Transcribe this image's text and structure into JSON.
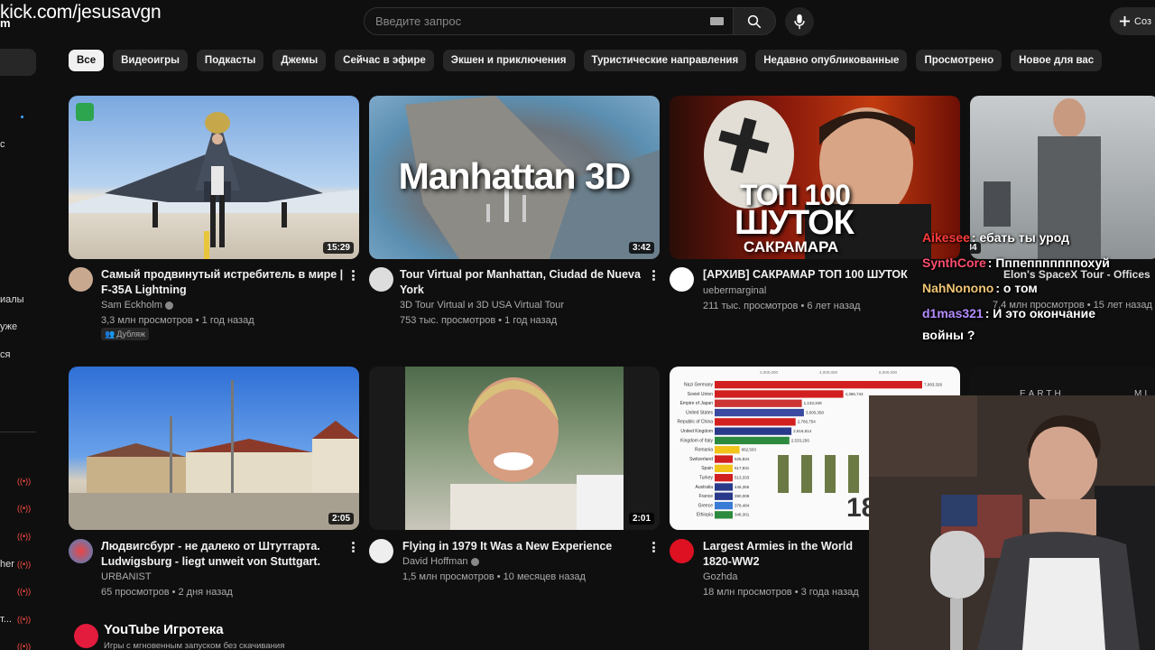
{
  "overlay": {
    "stream_url": "kick.com/jesusavgn",
    "sub_mark": "m"
  },
  "search": {
    "placeholder": "Введите запрос"
  },
  "header": {
    "create_label": "Соз"
  },
  "sidebar": {
    "fragments": [
      "с",
      "иалы",
      "уже",
      "ся",
      "her",
      "т..."
    ]
  },
  "chips": [
    "Все",
    "Видеоигры",
    "Подкасты",
    "Джемы",
    "Сейчас в эфире",
    "Экшен и приключения",
    "Туристические направления",
    "Недавно опубликованные",
    "Просмотрено",
    "Новое для вас"
  ],
  "videos": [
    {
      "title": "Самый продвинутый истребитель в мире | F-35A Lightning",
      "channel": "Sam Eckholm",
      "meta": "3,3 млн просмотров • 1 год назад",
      "duration": "15:29",
      "badge": "Дубляж"
    },
    {
      "title": "Tour Virtual por Manhattan, Ciudad de Nueva York",
      "channel": "3D Tour Virtual и 3D USA Virtual Tour",
      "meta": "753 тыс. просмотров • 1 год назад",
      "duration": "3:42",
      "thumb_text": "Manhattan 3D"
    },
    {
      "title": "[АРХИВ] САКРАМАР ТОП 100 ШУТОК",
      "channel": "uebermarginal",
      "meta": "211 тыс. просмотров • 6 лет назад",
      "thumb_text_1": "ТОП 100",
      "thumb_text_2": "ШУТОК",
      "thumb_text_3": "САКРАМАРА"
    },
    {
      "title": "Elon's SpaceX Tour - Offices",
      "meta": "7,4 млн просмотров • 15 лет назад",
      "duration": "45:34"
    },
    {
      "title": "Людвигсбург - не далеко от Штутгарта. Ludwigsburg - liegt unweit von Stuttgart.",
      "channel": "URBANIST",
      "meta": "65 просмотров • 2 дня назад",
      "duration": "2:05"
    },
    {
      "title": "Flying in 1979 It Was a New Experience",
      "channel": "David Hoffman",
      "meta": "1,5 млн просмотров • 10 месяцев назад",
      "duration": "2:01"
    },
    {
      "title": "Largest Armies in the World 1820-WW2",
      "channel": "Gozhda",
      "meta": "18 млн просмотров • 3 года назад",
      "thumb_corner": "18"
    }
  ],
  "chat": [
    {
      "user": "Aikesee",
      "color": "#ff3b3b",
      "text": ": ебать ты урод"
    },
    {
      "user": "SynthCore",
      "color": "#ff4d6d",
      "text": ": Пппепппппппохуй"
    },
    {
      "user": "NahNonono",
      "color": "#f0c674",
      "text": ": о том"
    },
    {
      "user": "d1mas321",
      "color": "#b48cff",
      "text": ": И это окончание"
    },
    {
      "user": "",
      "color": "#ffffff",
      "text": "войны ?"
    }
  ],
  "playables": {
    "title": "YouTube Игротека",
    "subtitle": "Игры с мгновенным запуском без скачивания"
  },
  "thumb4b": {
    "text_1": "EARTH",
    "text_2": "MI"
  },
  "army_chart": {
    "axis_ticks": [
      "2,000,000",
      "4,000,000",
      "6,000,000"
    ],
    "rows": [
      {
        "name": "Nazi Germany",
        "value": "7,083,326",
        "frac": 1.0,
        "color": "#d21f1f"
      },
      {
        "name": "Soviet Union",
        "value": "4,366,744",
        "frac": 0.62,
        "color": "#d21f1f"
      },
      {
        "name": "Empire of Japan",
        "value": "1,133,349",
        "frac": 0.42,
        "color": "#c33"
      },
      {
        "name": "United States",
        "value": "3,000,358",
        "frac": 0.43,
        "color": "#3a4aa0"
      },
      {
        "name": "Republic of China",
        "value": "2,766,754",
        "frac": 0.39,
        "color": "#d21f1f"
      },
      {
        "name": "United Kingdom",
        "value": "2,616,814",
        "frac": 0.37,
        "color": "#2a3a8a"
      },
      {
        "name": "Kingdom of Italy",
        "value": "2,533,256",
        "frac": 0.36,
        "color": "#2b8a3e"
      },
      {
        "name": "Romania",
        "value": "862,503",
        "frac": 0.12,
        "color": "#f2c318"
      },
      {
        "name": "Switzerland",
        "value": "525,834",
        "frac": 0.075,
        "color": "#d21f1f"
      },
      {
        "name": "Spain",
        "value": "517,831",
        "frac": 0.073,
        "color": "#f2c318"
      },
      {
        "name": "Turkey",
        "value": "513,333",
        "frac": 0.072,
        "color": "#d21f1f"
      },
      {
        "name": "Australia",
        "value": "446,355",
        "frac": 0.063,
        "color": "#2a3a8a"
      },
      {
        "name": "France",
        "value": "390,008",
        "frac": 0.055,
        "color": "#2a3a8a"
      },
      {
        "name": "Greece",
        "value": "378,484",
        "frac": 0.053,
        "color": "#3a7bd5"
      },
      {
        "name": "Ethiopia",
        "value": "348,301",
        "frac": 0.049,
        "color": "#2b8a3e"
      }
    ]
  }
}
